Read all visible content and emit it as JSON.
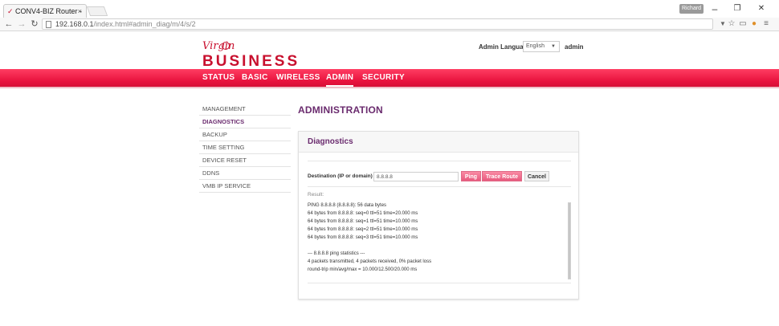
{
  "browser": {
    "tab_title": "CONV4-BIZ Router -",
    "tab_close": "×",
    "window_badge": "Richard",
    "window_controls": [
      "–",
      "❐",
      "✕"
    ],
    "url_host": "192.168.0.1",
    "url_path": "/index.html#admin_diag/m/4/s/2",
    "toolbar_icons": [
      "filter-icon",
      "star-icon",
      "cast-icon",
      "extension-icon",
      "menu-icon"
    ]
  },
  "header": {
    "logo_mark": "Virgin",
    "logo_text": "BUSINESS",
    "language_label": "Admin Language:",
    "language_value": "English",
    "user": "admin"
  },
  "nav": {
    "items": [
      {
        "label": "STATUS"
      },
      {
        "label": "BASIC"
      },
      {
        "label": "WIRELESS"
      },
      {
        "label": "ADMIN",
        "active": true
      },
      {
        "label": "SECURITY"
      }
    ]
  },
  "sidebar": {
    "items": [
      {
        "label": "MANAGEMENT"
      },
      {
        "label": "DIAGNOSTICS",
        "active": true
      },
      {
        "label": "BACKUP"
      },
      {
        "label": "TIME SETTING"
      },
      {
        "label": "DEVICE RESET"
      },
      {
        "label": "DDNS"
      },
      {
        "label": "VMB IP SERVICE"
      }
    ]
  },
  "main": {
    "page_title": "ADMINISTRATION",
    "panel_title": "Diagnostics",
    "destination_label": "Destination (IP or domain)",
    "destination_value": "8.8.8.8",
    "ping_label": "Ping",
    "trace_label": "Trace Route",
    "cancel_label": "Cancel",
    "result_label": "Result:",
    "result_lines": [
      "PING 8.8.8.8 (8.8.8.8): 56 data bytes",
      "64 bytes from 8.8.8.8: seq=0 ttl=51 time=20.000 ms",
      "64 bytes from 8.8.8.8: seq=1 ttl=51 time=10.000 ms",
      "64 bytes from 8.8.8.8: seq=2 ttl=51 time=10.000 ms",
      "64 bytes from 8.8.8.8: seq=3 ttl=51 time=10.000 ms",
      "",
      "--- 8.8.8.8 ping statistics ---",
      "4 packets transmitted, 4 packets received, 0% packet loss",
      "round-trip min/avg/max = 10.000/12.500/20.000 ms"
    ]
  },
  "colors": {
    "brand_red": "#c8102e",
    "nav_pink": "#e8123d",
    "accent_purple": "#6a2b6e",
    "button_pink": "#e85a7e"
  }
}
